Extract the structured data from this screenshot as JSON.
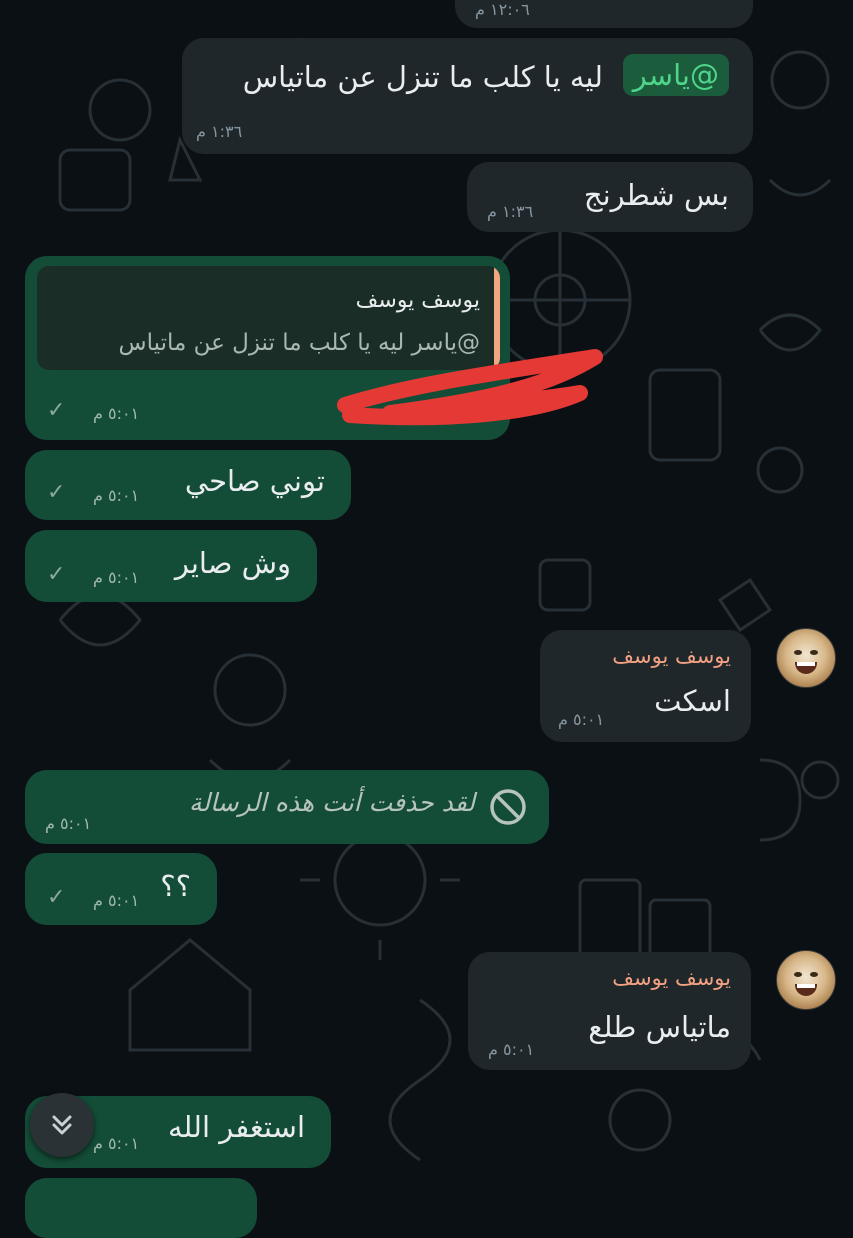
{
  "chat": {
    "top_partial": {
      "time": "١٢:٠٦ م"
    },
    "messages": [
      {
        "mention": "@ياسر",
        "text": "ليه يا كلب ما تنزل عن ماتياس",
        "time": "١:٣٦ م"
      },
      {
        "text": "بس شطرنج",
        "time": "١:٣٦ م"
      },
      {
        "quote_name": "يوسف يوسف",
        "quote_text": "@ياسر ليه يا كلب ما تنزل عن ماتياس",
        "time": "٥:٠١ م"
      },
      {
        "text": "توني صاحي",
        "time": "٥:٠١ م"
      },
      {
        "text": "وش صاير",
        "time": "٥:٠١ م"
      },
      {
        "sender": "يوسف يوسف",
        "text": "اسكت",
        "time": "٥:٠١ م"
      },
      {
        "deleted_text": "لقد حذفت أنت هذه الرسالة",
        "time": "٥:٠١ م"
      },
      {
        "text": "؟؟",
        "time": "٥:٠١ م"
      },
      {
        "sender": "يوسف يوسف",
        "text": "ماتياس طلع",
        "time": "٥:٠١ م"
      },
      {
        "text": "استغفر الله",
        "time": "٥:٠١ م"
      }
    ]
  },
  "icons": {
    "read_tick": "✓",
    "scroll_down": "double-chevron-down-icon",
    "deleted": "block-icon"
  },
  "colors": {
    "incoming_bubble": "#1f272a",
    "outgoing_bubble": "#144d37",
    "sender_name": "#f3a183",
    "mention": "#4fd48a",
    "redaction": "#e53935"
  }
}
